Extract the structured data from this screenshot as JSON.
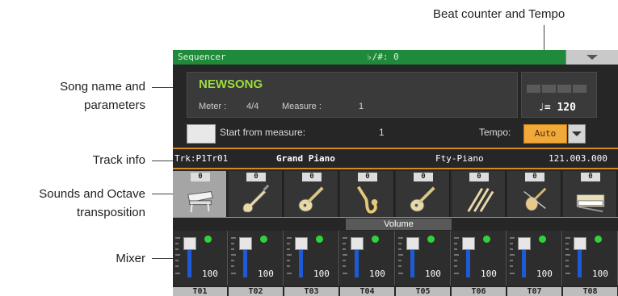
{
  "callouts": {
    "beat_tempo": "Beat counter and Tempo",
    "song_line1": "Song name and",
    "song_line2": "parameters",
    "track_info": "Track info",
    "sounds_line1": "Sounds and Octave",
    "sounds_line2": "transposition",
    "mixer": "Mixer"
  },
  "title_bar": {
    "title": "Sequencer",
    "transpose": "♭/#: 0",
    "menu_icon": "chevron-down-icon"
  },
  "song": {
    "name": "NEWSONG",
    "meter_label": "Meter :",
    "meter_value": "4/4",
    "measure_label": "Measure :",
    "measure_value": "1"
  },
  "tempo_display": {
    "value": "♩= 120"
  },
  "start_from": {
    "label": "Start from measure:",
    "value": "1"
  },
  "tempo_mode": {
    "label": "Tempo:",
    "value": "Auto"
  },
  "track_info": {
    "track": "Trk:P1Tr01",
    "sound": "Grand Piano",
    "category": "Fty-Piano",
    "bank": "121.003.000"
  },
  "volume_label": "Volume",
  "tracks": [
    {
      "label": "T01",
      "octave": "0",
      "instrument": "piano-icon",
      "volume": "100"
    },
    {
      "label": "T02",
      "octave": "0",
      "instrument": "electric-guitar-icon",
      "volume": "100"
    },
    {
      "label": "T03",
      "octave": "0",
      "instrument": "acoustic-guitar-icon",
      "volume": "100"
    },
    {
      "label": "T04",
      "octave": "0",
      "instrument": "saxophone-icon",
      "volume": "100"
    },
    {
      "label": "T05",
      "octave": "0",
      "instrument": "acoustic-guitar-icon",
      "volume": "100"
    },
    {
      "label": "T06",
      "octave": "0",
      "instrument": "drumsticks-icon",
      "volume": "100"
    },
    {
      "label": "T07",
      "octave": "0",
      "instrument": "violin-icon",
      "volume": "100"
    },
    {
      "label": "T08",
      "octave": "0",
      "instrument": "keyboard-icon",
      "volume": "100"
    }
  ],
  "colors": {
    "title_bar": "#1f8a3a",
    "song_name": "#9bdc3c",
    "accent": "#d48a1c",
    "fader": "#1d5bd6",
    "led": "#31d13a",
    "tempo_select": "#f2a93b"
  }
}
